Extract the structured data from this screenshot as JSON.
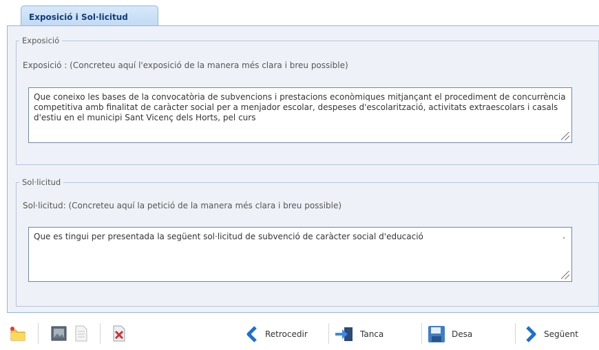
{
  "tab": {
    "label": "Exposició i Sol·licitud"
  },
  "exposicio": {
    "legend": "Exposició",
    "hint": "Exposició : (Concreteu aquí l'exposició de la manera més clara i breu possible)",
    "value": "Que coneixo les bases de la convocatòria de subvencions i prestacions econòmiques mitjançant el procediment de concurrència competitiva amb finalitat de caràcter social per a menjador escolar, despeses d'escolarització, activitats extraescolars i casals d'estiu en el municipi Sant Vicenç dels Horts, pel curs"
  },
  "solicitud": {
    "legend": "Sol·licitud",
    "hint": "Sol·licitud: (Concreteu aquí la petició de la manera més clara i breu possible)",
    "value": "Que es tingui per presentada la següent sol·licitud de subvenció de caràcter social d'educació"
  },
  "toolbar": {
    "back_label": "Retrocedir",
    "close_label": "Tanca",
    "save_label": "Desa",
    "next_label": "Següent"
  },
  "icons": [
    "folder-icon",
    "image-icon",
    "document-icon",
    "delete-document-icon",
    "arrow-left-icon",
    "exit-icon",
    "floppy-disk-icon",
    "arrow-right-icon"
  ]
}
